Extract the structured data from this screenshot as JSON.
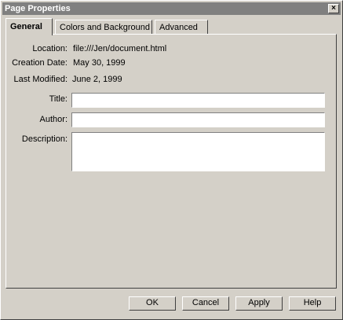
{
  "window": {
    "title": "Page Properties",
    "close_glyph": "×"
  },
  "tabs": [
    {
      "label": "General",
      "active": true
    },
    {
      "label": "Colors and Background",
      "active": false
    },
    {
      "label": "Advanced",
      "active": false
    }
  ],
  "info": {
    "location_label": "Location:",
    "location_value": "file:///Jen/document.html",
    "creation_label": "Creation Date:",
    "creation_value": "May 30, 1999",
    "modified_label": "Last Modified:",
    "modified_value": "June 2, 1999"
  },
  "form": {
    "title_label": "Title:",
    "title_value": "",
    "author_label": "Author:",
    "author_value": "",
    "description_label": "Description:",
    "description_value": ""
  },
  "buttons": {
    "ok": "OK",
    "cancel": "Cancel",
    "apply": "Apply",
    "help": "Help"
  },
  "colors": {
    "face": "#d4d0c8",
    "titlebar": "#808080",
    "field": "#ffffff"
  }
}
